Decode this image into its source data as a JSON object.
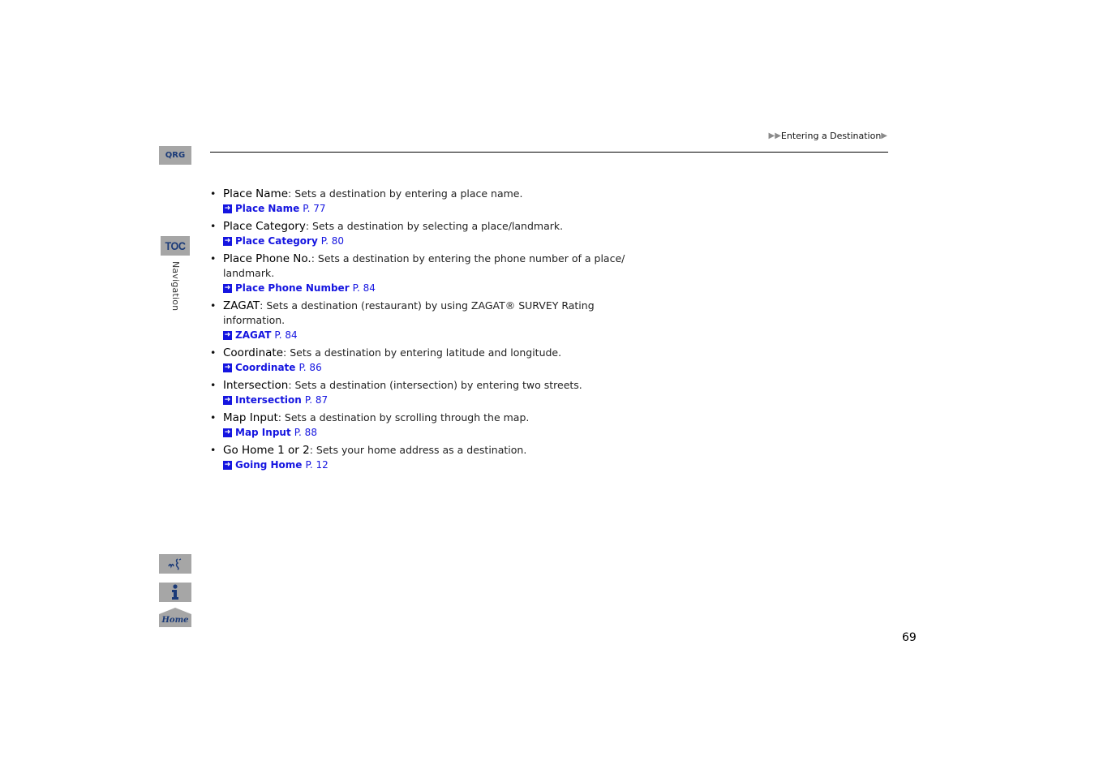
{
  "sidebar": {
    "qrg_label": "QRG",
    "toc_label": "TOC",
    "section_label": "Navigation",
    "home_label": "Home"
  },
  "header": {
    "breadcrumb": "Entering a Destination"
  },
  "items": [
    {
      "term": "Place Name",
      "desc": ": Sets a destination by entering a place name.",
      "ref_title": "Place Name",
      "ref_page": "P. 77"
    },
    {
      "term": "Place Category",
      "desc": ": Sets a destination by selecting a place/landmark.",
      "ref_title": "Place Category",
      "ref_page": "P. 80"
    },
    {
      "term": "Place Phone No.",
      "desc": ": Sets a destination by entering the phone number of a place/ landmark.",
      "ref_title": "Place Phone Number",
      "ref_page": "P. 84"
    },
    {
      "term": "ZAGAT",
      "desc": ": Sets a destination (restaurant) by using ZAGAT® SURVEY Rating information.",
      "ref_title": "ZAGAT",
      "ref_page": "P. 84"
    },
    {
      "term": "Coordinate",
      "desc": ": Sets a destination by entering latitude and longitude.",
      "ref_title": "Coordinate",
      "ref_page": "P. 86"
    },
    {
      "term": "Intersection",
      "desc": ": Sets a destination (intersection) by entering two streets.",
      "ref_title": "Intersection",
      "ref_page": "P. 87"
    },
    {
      "term": "Map Input",
      "desc": ": Sets a destination by scrolling through the map.",
      "ref_title": "Map Input",
      "ref_page": "P. 88"
    },
    {
      "term": "Go Home 1 or 2",
      "desc": ": Sets your home address as a destination.",
      "ref_title": "Going Home",
      "ref_page": "P. 12"
    }
  ],
  "footer": {
    "page_number": "69"
  }
}
